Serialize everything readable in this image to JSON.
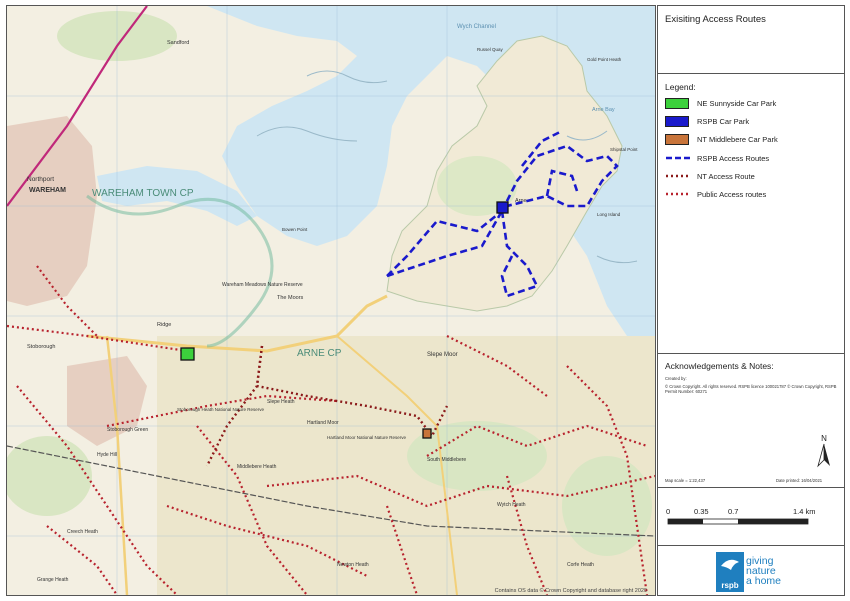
{
  "title": "Exisiting Access Routes",
  "legend": {
    "heading": "Legend:",
    "items": [
      {
        "label": "NE Sunnyside Car Park",
        "color": "#3cd13c",
        "kind": "box"
      },
      {
        "label": "RSPB Car Park",
        "color": "#1a1acc",
        "kind": "box"
      },
      {
        "label": "NT Middlebere Car Park",
        "color": "#c8743a",
        "kind": "box"
      },
      {
        "label": "RSPB Access Routes",
        "color": "#1a1acc",
        "kind": "dash"
      },
      {
        "label": "NT Access Route",
        "color": "#8b1a1a",
        "kind": "dot"
      },
      {
        "label": "Public Access routes",
        "color": "#b8232e",
        "kind": "dot"
      }
    ]
  },
  "notes": {
    "heading": "Acknowledgements & Notes:",
    "created_by": "Created by:",
    "copyright": "© Crown Copyright.  All rights reserved. RSPB licence 100021787 © Crown Copyright, RSPB Permit Number: 60271",
    "map_scale": "Map scale = 1:22,437",
    "date_printed": "Date printed: 16/04/2021",
    "north": "N"
  },
  "scale_bar": {
    "ticks": [
      "0",
      "0.35",
      "0.7",
      "1.4 km"
    ]
  },
  "logo": {
    "line1": "giving",
    "line2": "nature",
    "line3": "a home",
    "brand": "rspb"
  },
  "map": {
    "credit": "Contains OS data © Crown Copyright and database right 2020",
    "places": {
      "wareham_town_cp": "WAREHAM TOWN CP",
      "northport": "Northport",
      "wareham": "WAREHAM",
      "arne_cp": "ARNE CP",
      "slepe_moor": "Slepe Moor",
      "slepe_heath": "Slepe Heath",
      "hartland_moor": "Hartland Moor",
      "middlebere_heath": "Middlebere Heath",
      "wareham_meadows": "Wareham Meadows Nature Reserve",
      "the_moors": "The Moors",
      "sandford": "Sandford",
      "arne": "Arne",
      "stoborough": "Stoborough",
      "stoborough_heath": "Stoborough Heath National Nature Reserve",
      "stoborough_green": "Stoborough Green",
      "ridge": "Ridge",
      "south_middlebere": "South Middlebere",
      "wytch_heath": "Wytch Heath",
      "gold_point_heath": "Gold Point Heath",
      "shipstal_point": "Shipstal Point",
      "hyde_hill": "Hyde Hill",
      "creech_heath": "Creech Heath",
      "grange_heath": "Grange Heath",
      "newton_heath": "Newton Heath",
      "bowen_point": "Bowen Point",
      "hartland_moor_nnr": "Hartland Moor National Nature Reserve",
      "russel_quay": "Russel Quay",
      "arne_bay": "Arne Bay",
      "wych_channel": "Wych Channel",
      "long_island": "Long Island",
      "corfe_heath": "Corfe Heath"
    }
  }
}
